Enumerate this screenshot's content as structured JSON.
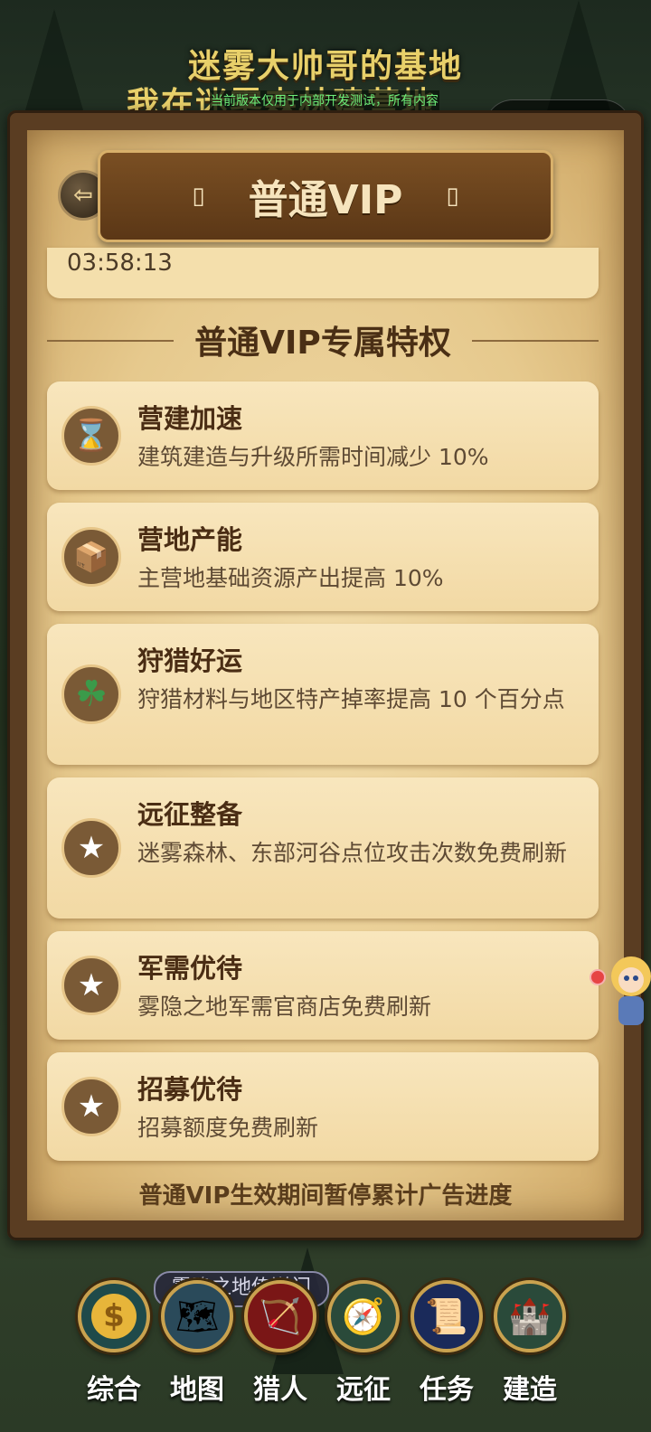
{
  "game": {
    "title": "迷雾大帅哥的基地",
    "subtitle": "我在迷雾森林建营地"
  },
  "system": {
    "dev_notice": "当前版本仅用于内部开发测试，所有内容均不面向用户",
    "capsule_more": "•••"
  },
  "header": {
    "title": "普通VIP",
    "left_glyph": "▯",
    "right_glyph": "▯",
    "back_icon": "arrow-left-icon"
  },
  "timer": {
    "value": "03:58:13"
  },
  "section": {
    "title": "普通VIP专属特权"
  },
  "perks": [
    {
      "name": "营建加速",
      "desc": "建筑建造与升级所需时间减少 10%",
      "icon": "hourglass-icon",
      "glyph": "⌛"
    },
    {
      "name": "营地产能",
      "desc": "主营地基础资源产出提高 10%",
      "icon": "crate-icon",
      "glyph": "📦"
    },
    {
      "name": "狩猎好运",
      "desc": "狩猎材料与地区特产掉率提高 10 个百分点",
      "icon": "clover-icon",
      "glyph": "☘"
    },
    {
      "name": "远征整备",
      "desc": "迷雾森林、东部河谷点位攻击次数免费刷新",
      "icon": "star-icon",
      "glyph": "★"
    },
    {
      "name": "军需优待",
      "desc": "雾隐之地军需官商店免费刷新",
      "icon": "star-icon",
      "glyph": "★"
    },
    {
      "name": "招募优待",
      "desc": "招募额度免费刷新",
      "icon": "star-icon",
      "glyph": "★"
    }
  ],
  "footer_note": "普通VIP生效期间暂停累计广告进度",
  "tooltip": "雾隐之地传送门",
  "nav": [
    {
      "label": "综合",
      "icon": "coin-icon",
      "glyph": "$",
      "color": "#1f4a4a"
    },
    {
      "label": "地图",
      "icon": "map-icon",
      "glyph": "🗺",
      "color": "#2a4a5a"
    },
    {
      "label": "猎人",
      "icon": "bow-icon",
      "glyph": "🏹",
      "color": "#7a1616"
    },
    {
      "label": "远征",
      "icon": "compass-icon",
      "glyph": "🧭",
      "color": "#2a4a3a"
    },
    {
      "label": "任务",
      "icon": "scroll-icon",
      "glyph": "📜",
      "color": "#1a2a5a"
    },
    {
      "label": "建造",
      "icon": "castle-icon",
      "glyph": "🏰",
      "color": "#2a4a3a"
    }
  ],
  "colors": {
    "parchment": "#f2d9a4",
    "wood": "#5a3d22",
    "accent_gold": "#c9a24f",
    "text_brown": "#4a2d14"
  }
}
